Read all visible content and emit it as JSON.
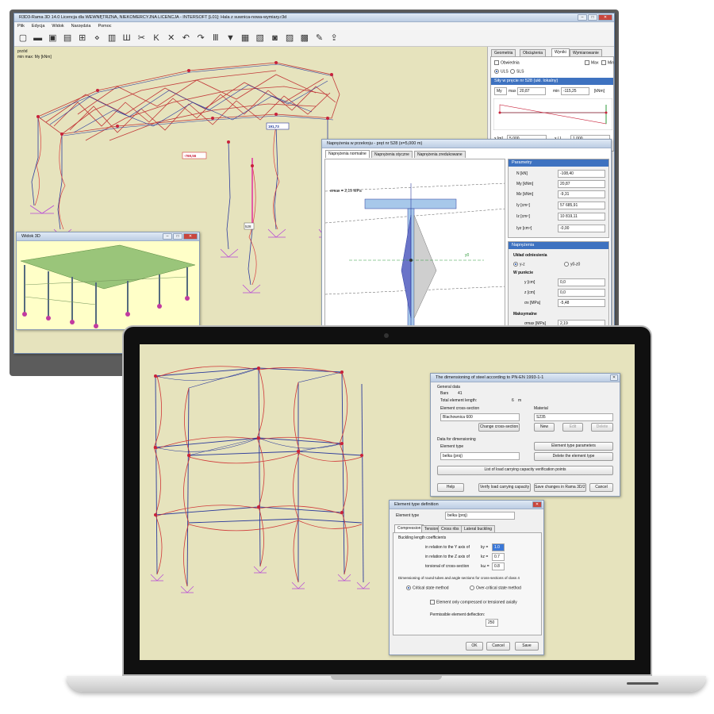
{
  "desktop": {
    "title": "R3D3-Rama 3D 14.0 Licencja dla WEWNĘTRZNA, NIEKOMERCYJNA LICENCJA - INTERSOFT [L01]: Hala z suwnica-nowa-wymiary.r3d",
    "menu": [
      "Plik",
      "Edycja",
      "Widok",
      "Narzędzia",
      "Pomoc"
    ],
    "toolbar_icons": [
      "new-icon",
      "open-icon",
      "save-icon",
      "save-as-icon",
      "grid-icon",
      "nodes-icon",
      "bars-icon",
      "supports-icon",
      "cut-icon",
      "loads-icon",
      "delete-icon",
      "undo-icon",
      "redo-icon",
      "sections-icon",
      "filter-icon",
      "table-icon",
      "results-icon",
      "camera-icon",
      "report-icon",
      "print-icon",
      "tools-icon",
      "export-icon"
    ],
    "viewport": {
      "view_label": "przód",
      "result_label": "min max: My [kNm]",
      "max_value": "191,73",
      "min_value": "-769,56",
      "bar_label": "528"
    },
    "panel": {
      "tabs": [
        "Geometria",
        "Obciążenia",
        "Wyniki",
        "Wymiarowanie"
      ],
      "active_tab": "Wyniki",
      "envelope_label": "Obwiednia",
      "max_label": "Max",
      "min_label": "Min",
      "uls_label": "ULS",
      "sls_label": "SLS",
      "forces_header": "Siły w pręcie nr 528 (ukł. lokalny)",
      "force_select": "My",
      "max_key": "max",
      "max_val": "20,87",
      "min_key": "min",
      "min_val": "-115,25",
      "unit": "[kNm]",
      "x_label": "x [m]",
      "x_val": "5,000",
      "xl_label": "x / L",
      "xl_val": "1,000"
    },
    "window_3d": {
      "title": "Widok 3D"
    },
    "stress_window": {
      "title": "Naprężenia w przekroju - pręt nr 528 (x=5,000 m)",
      "tabs": [
        "Naprężenia normalne",
        "Naprężenia styczne",
        "Naprężenia zredukowane"
      ],
      "sigma_label": "σmax = 2,19 MPa",
      "axis_label": "y0",
      "params_header": "Parametry",
      "params": [
        {
          "label": "N [kN]",
          "value": "-108,40"
        },
        {
          "label": "My [kNm]",
          "value": "20,87"
        },
        {
          "label": "Mz [kNm]",
          "value": "-9,31"
        },
        {
          "label": "Iy [cm⁴]",
          "value": "57 685,91"
        },
        {
          "label": "Iz [cm⁴]",
          "value": "10 819,11"
        },
        {
          "label": "Iyz [cm⁴]",
          "value": "-0,00"
        }
      ],
      "stress_header": "Naprężenia",
      "coord_label": "Układ odniesienia",
      "coord_opt1": "y-z",
      "coord_opt2": "y0-z0",
      "point_label": "W punkcie",
      "point_fields": [
        {
          "label": "y [cm]",
          "value": "0,0"
        },
        {
          "label": "z [cm]",
          "value": "0,0"
        },
        {
          "label": "σx [MPa]",
          "value": "-5,48"
        }
      ],
      "max_header": "Maksymalne",
      "sigma_max_label": "σmax [MPa]",
      "sigma_max_value": "2,19"
    }
  },
  "laptop": {
    "dim_dialog": {
      "title": "The dimensioning of steel according to PN-EN 1993-1-1",
      "general_label": "General data",
      "bars_label": "Bars",
      "bars_value": "41",
      "length_label": "Total element length:",
      "length_value": "6",
      "length_unit": "m",
      "cross_section_label": "Element cross-section",
      "cross_section_value": "Blachownica 600",
      "change_cs_button": "Change cross-section",
      "material_label": "Material",
      "material_value": "S235",
      "new_button": "New",
      "edit_button": "Edit",
      "delete_button": "Delete",
      "data_label": "Data for dimensioning",
      "element_type_label": "Element type",
      "element_type_value": "belka (proj)",
      "type_params_button": "Element type parameters",
      "delete_type_button": "Delete the element type",
      "verification_button": "List of load carrying capacity verification points",
      "help_button": "Help",
      "verify_button": "Verify load carrying capacity",
      "save_button": "Save changes in Rama 3D/2D",
      "cancel_button": "Cancel"
    },
    "type_dialog": {
      "title": "Element type definition",
      "element_type_label": "Element type",
      "element_type_value": "belka (proj)",
      "tabs": [
        "Compression",
        "Tension",
        "Cross ribs",
        "Lateral buckling"
      ],
      "active_tab": "Compression",
      "buckling_label": "Buckling length coefficients",
      "coeffs": [
        {
          "label": "in relation to the Y axis of",
          "key": "ky =",
          "value": "1.0"
        },
        {
          "label": "in relation to the Z axis of",
          "key": "kz =",
          "value": "0.7"
        },
        {
          "label": "torsional of cross-section",
          "key": "kω =",
          "value": "0.8"
        }
      ],
      "dim_round_label": "Dimensioning of round tubes and angle sections for cross-sections of class 4",
      "critical_label": "Critical state method",
      "overcritical_label": "Over-critical state method",
      "axial_label": "Element only compressed or tensioned axially",
      "deflection_label": "Permissible element deflection:",
      "deflection_value": "250",
      "ok_button": "OK",
      "cancel_button": "Cancel",
      "save_button": "Save"
    }
  },
  "colors": {
    "viewport_bg": "#e6e3bd",
    "accent_blue": "#3e72c0",
    "frame_red": "#d23c3c",
    "frame_blue": "#2b3a9b",
    "laptop_body": "#e3e3e3"
  }
}
